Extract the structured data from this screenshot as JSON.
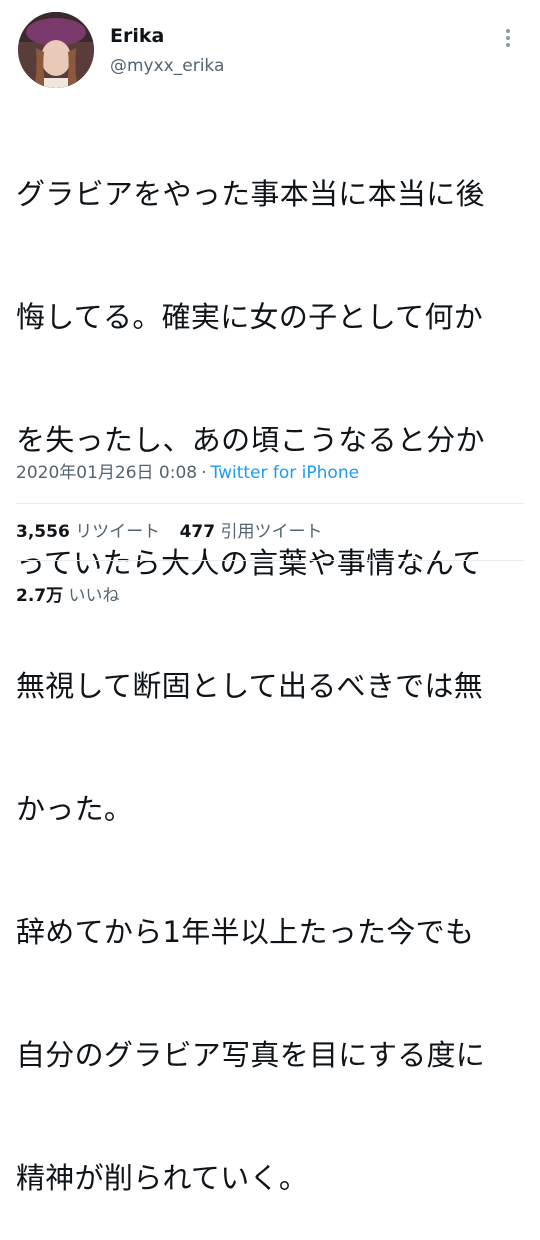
{
  "user": {
    "display_name": "Erika",
    "handle": "@myxx_erika"
  },
  "tweet": {
    "lines": [
      "グラビアをやった事本当に本当に後",
      "悔してる。確実に女の子として何か",
      "を失ったし、あの頃こうなると分か",
      "っていたら大人の言葉や事情なんて",
      "無視して断固として出るべきでは無",
      "かった。",
      "辞めてから1年半以上たった今でも",
      "自分のグラビア写真を目にする度に",
      "精神が削られていく。"
    ],
    "timestamp": "2020年01月26日 0:08",
    "separator": "·",
    "source": "Twitter for iPhone"
  },
  "stats": {
    "retweets_count": "3,556",
    "retweets_label": "リツイート",
    "quotes_count": "477",
    "quotes_label": "引用ツイート",
    "likes_count": "2.7万",
    "likes_label": "いいね"
  },
  "icons": {
    "more": "more-vertical-icon"
  }
}
